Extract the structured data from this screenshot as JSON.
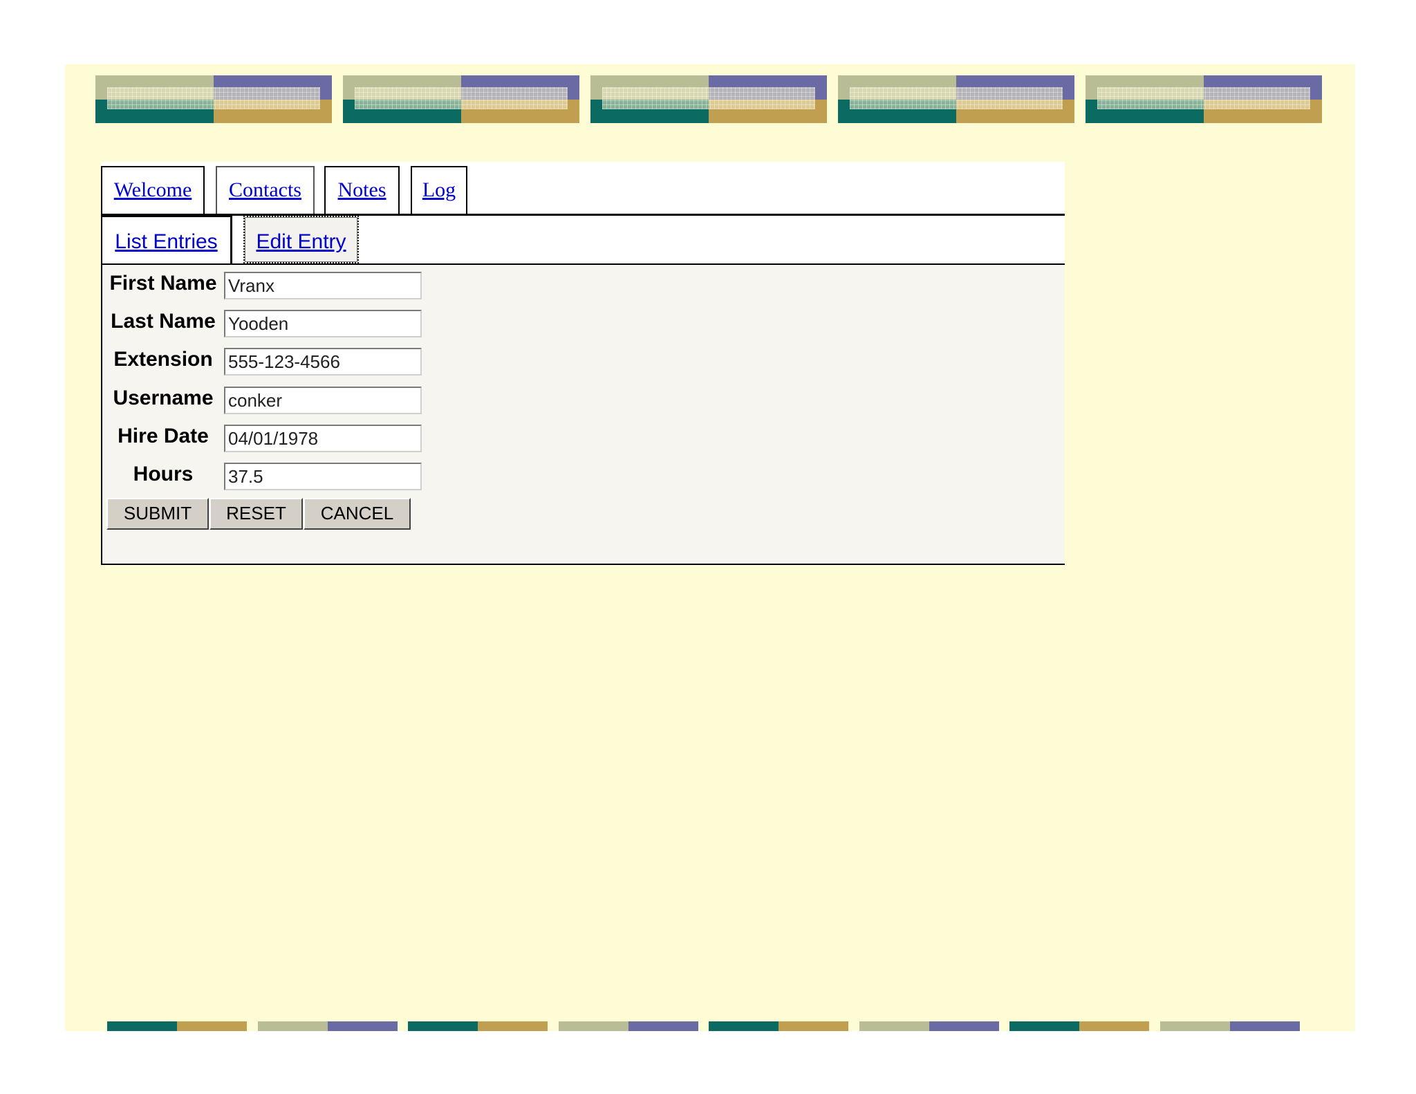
{
  "colors": {
    "background": "#fefcd5",
    "sage": "#b9bd96",
    "purple": "#6a6aa4",
    "teal": "#0b6a61",
    "gold": "#c09f50",
    "link": "#0000cc"
  },
  "tabs": [
    {
      "label": "Welcome"
    },
    {
      "label": "Contacts"
    },
    {
      "label": "Notes"
    },
    {
      "label": "Log"
    }
  ],
  "subtabs": [
    {
      "label": "List Entries"
    },
    {
      "label": "Edit Entry"
    }
  ],
  "form": {
    "fields": [
      {
        "label": "First Name",
        "value": "Vranx"
      },
      {
        "label": "Last Name",
        "value": "Yooden"
      },
      {
        "label": "Extension",
        "value": "555-123-4566"
      },
      {
        "label": "Username",
        "value": "conker"
      },
      {
        "label": "Hire Date",
        "value": "04/01/1978"
      },
      {
        "label": "Hours",
        "value": "37.5"
      }
    ],
    "buttons": {
      "submit": "SUBMIT",
      "reset": "RESET",
      "cancel": "CANCEL"
    }
  }
}
